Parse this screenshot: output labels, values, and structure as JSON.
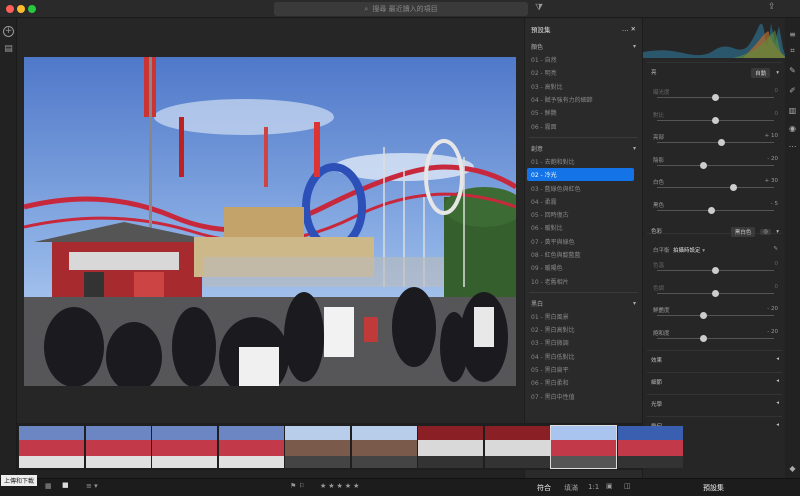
{
  "titlebar": {
    "search_placeholder": "搜尋 最近讀入的項目"
  },
  "presets_panel": {
    "title": "預設集",
    "groups": [
      {
        "name": "顏色",
        "items": [
          "01 - 自然",
          "02 - 明亮",
          "03 - 高對比",
          "04 - 賦予強有力的細節",
          "05 - 鮮艷",
          "06 - 霧面"
        ]
      },
      {
        "name": "創意",
        "items": [
          "01 - 去飽和對比",
          "02 - 冷光",
          "03 - 藍綠色與紅色",
          "04 - 柔霧",
          "05 - 回時復古",
          "06 - 暖對比",
          "07 - 黃平與綠色",
          "08 - 紅色與靛藍藍",
          "09 - 暖陽色",
          "10 - 老舊相片"
        ]
      },
      {
        "name": "黑白",
        "items": [
          "01 - 黑白風景",
          "02 - 黑白高對比",
          "03 - 黑白微調",
          "04 - 黑白低對比",
          "05 - 黑白扁平",
          "06 - 黑白柔和",
          "07 - 黑白中性值"
        ]
      }
    ],
    "selected": "02 - 冷光"
  },
  "edit_panel": {
    "light": {
      "title": "亮",
      "auto_label": "自動",
      "sliders": [
        {
          "label": "曝光度",
          "value": "0",
          "level": 0.5,
          "dim": true
        },
        {
          "label": "對比",
          "value": "0",
          "level": 0.5,
          "dim": true
        },
        {
          "label": "亮部",
          "value": "+ 10",
          "level": 0.55,
          "dim": false
        },
        {
          "label": "陰影",
          "value": "- 20",
          "level": 0.4,
          "dim": false
        },
        {
          "label": "白色",
          "value": "+ 30",
          "level": 0.65,
          "dim": false
        },
        {
          "label": "黑色",
          "value": "- 5",
          "level": 0.47,
          "dim": false
        }
      ]
    },
    "color": {
      "title": "色彩",
      "bw_label": "黑白色",
      "wb_label": "白平衡",
      "wb_value": "拍攝時設定",
      "sliders": [
        {
          "label": "色溫",
          "value": "0",
          "level": 0.5,
          "dim": true
        },
        {
          "label": "色調",
          "value": "0",
          "level": 0.5,
          "dim": true
        },
        {
          "label": "鮮艷度",
          "value": "- 20",
          "level": 0.4,
          "dim": false
        },
        {
          "label": "飽和度",
          "value": "- 20",
          "level": 0.4,
          "dim": false
        }
      ]
    },
    "sections": [
      "效果",
      "細節",
      "光學",
      "幾何"
    ]
  },
  "bottom": {
    "tooltip": "上傳和下載",
    "fit": "符合",
    "fill": "填滿",
    "ratio": "1:1",
    "presets_button": "預設集"
  },
  "colors": {
    "accent": "#1473e6",
    "panel": "#2a2a2a"
  }
}
